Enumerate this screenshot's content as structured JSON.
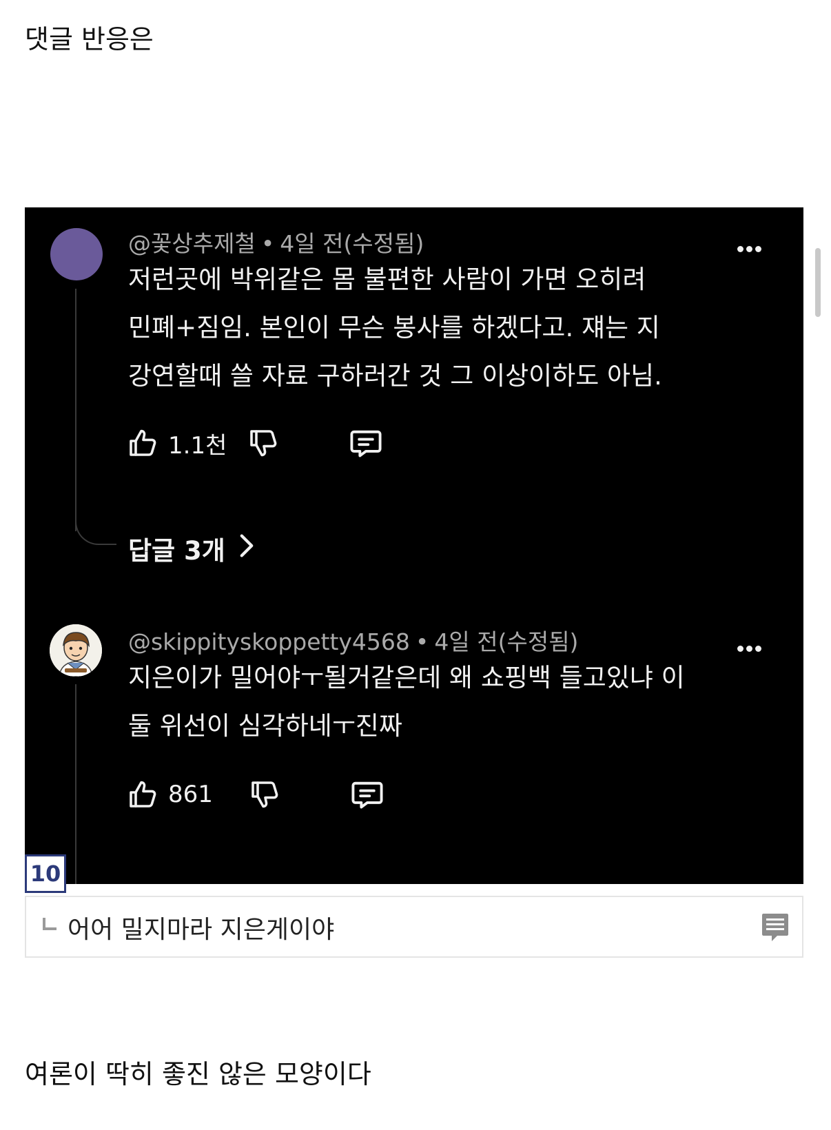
{
  "intro_text": "댓글 반응은",
  "outro_text": "여론이 딱히 좋진 않은 모양이다",
  "comments": [
    {
      "author": "@꽃상추제철",
      "age": "4일 전(수정됨)",
      "text_lines": [
        "저런곳에 박위같은 몸 불편한 사람이 가면 오히려",
        "민폐+짐임. 본인이 무슨 봉사를 하겠다고. 쟤는 지",
        "강연할때 쓸 자료 구하러간 것 그 이상이하도 아님."
      ],
      "likes": "1.1천",
      "replies_label": "답글 3개",
      "avatar_color": "#6a5a9a"
    },
    {
      "author": "@skippityskoppetty4568",
      "age": "4일 전(수정됨)",
      "text_lines": [
        "지은이가 밀어야ㅜ될거같은데 왜 쇼핑백 들고있냐 이",
        "둘 위선이 심각하네ㅜ진짜"
      ],
      "likes": "861"
    }
  ],
  "dot_separator": "•",
  "reply": {
    "number": "10",
    "text": "어어 밀지마라 지은게이야"
  },
  "icons": {
    "like": "thumbs-up-icon",
    "dislike": "thumbs-down-icon",
    "reply": "comment-icon",
    "more": "more-dots-icon",
    "replies_chevron": "chevron-right-icon",
    "memo": "memo-icon"
  },
  "colors": {
    "panel_background": "#000000",
    "meta_text": "#aaaaaa",
    "body_text": "#f1f1f1",
    "badge_border": "#2c3a7a"
  }
}
